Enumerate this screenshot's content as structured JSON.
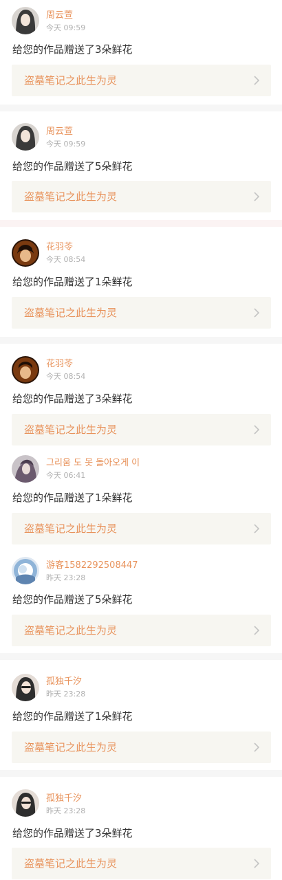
{
  "notifications": [
    {
      "name": "周云萱",
      "time": "今天 09:59",
      "message": "给您的作品赠送了3朵鲜花",
      "work_title": "盗墓笔记之此生为灵",
      "avatar_icon": "user-avatar-icon",
      "avatar_color": "#3a3a3a"
    },
    {
      "name": "周云萱",
      "time": "今天 09:59",
      "message": "给您的作品赠送了5朵鲜花",
      "work_title": "盗墓笔记之此生为灵",
      "avatar_icon": "user-avatar-icon",
      "avatar_color": "#3a3a3a"
    },
    {
      "name": "花羽苓",
      "time": "今天 08:54",
      "message": "给您的作品赠送了1朵鲜花",
      "work_title": "盗墓笔记之此生为灵",
      "avatar_icon": "user-avatar-icon",
      "avatar_color": "#7a3a10"
    },
    {
      "name": "花羽苓",
      "time": "今天 08:54",
      "message": "给您的作品赠送了3朵鲜花",
      "work_title": "盗墓笔记之此生为灵",
      "avatar_icon": "user-avatar-icon",
      "avatar_color": "#7a3a10"
    },
    {
      "name": "그리움 도 못 돌아오게 이",
      "time": "今天 06:41",
      "message": "给您的作品赠送了1朵鲜花",
      "work_title": "盗墓笔记之此生为灵",
      "avatar_icon": "user-avatar-icon",
      "avatar_color": "#6b5a6e"
    },
    {
      "name": "游客1582292508447",
      "time": "昨天 23:28",
      "message": "给您的作品赠送了5朵鲜花",
      "work_title": "盗墓笔记之此生为灵",
      "avatar_icon": "user-avatar-icon",
      "avatar_color": "#8fb4d8"
    },
    {
      "name": "孤独千汐",
      "time": "昨天 23:28",
      "message": "给您的作品赠送了1朵鲜花",
      "work_title": "盗墓笔记之此生为灵",
      "avatar_icon": "user-avatar-icon",
      "avatar_color": "#2e2e2e"
    },
    {
      "name": "孤独千汐",
      "time": "昨天 23:28",
      "message": "给您的作品赠送了3朵鲜花",
      "work_title": "盗墓笔记之此生为灵",
      "avatar_icon": "user-avatar-icon",
      "avatar_color": "#2e2e2e"
    }
  ],
  "colors": {
    "accent": "#e8935c",
    "muted": "#b0b0b0",
    "text": "#333333",
    "work_bg": "#f7f6f1",
    "separator": "#f6f6f6"
  }
}
